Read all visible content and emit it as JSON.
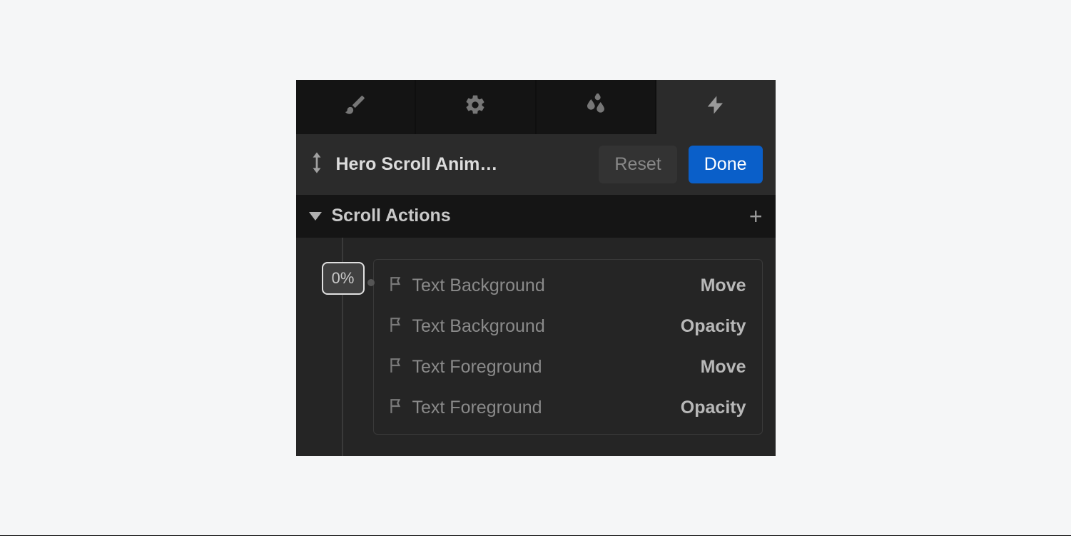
{
  "tabs": {
    "style_active": false,
    "settings_active": false,
    "effects_active": false,
    "interactions_active": true
  },
  "header": {
    "animation_name": "Hero Scroll Anim…",
    "reset_label": "Reset",
    "done_label": "Done"
  },
  "section": {
    "title": "Scroll Actions"
  },
  "keyframe": {
    "marker": "0%",
    "actions": [
      {
        "target": "Text Background",
        "type": "Move"
      },
      {
        "target": "Text Background",
        "type": "Opacity"
      },
      {
        "target": "Text Foreground",
        "type": "Move"
      },
      {
        "target": "Text Foreground",
        "type": "Opacity"
      }
    ]
  }
}
